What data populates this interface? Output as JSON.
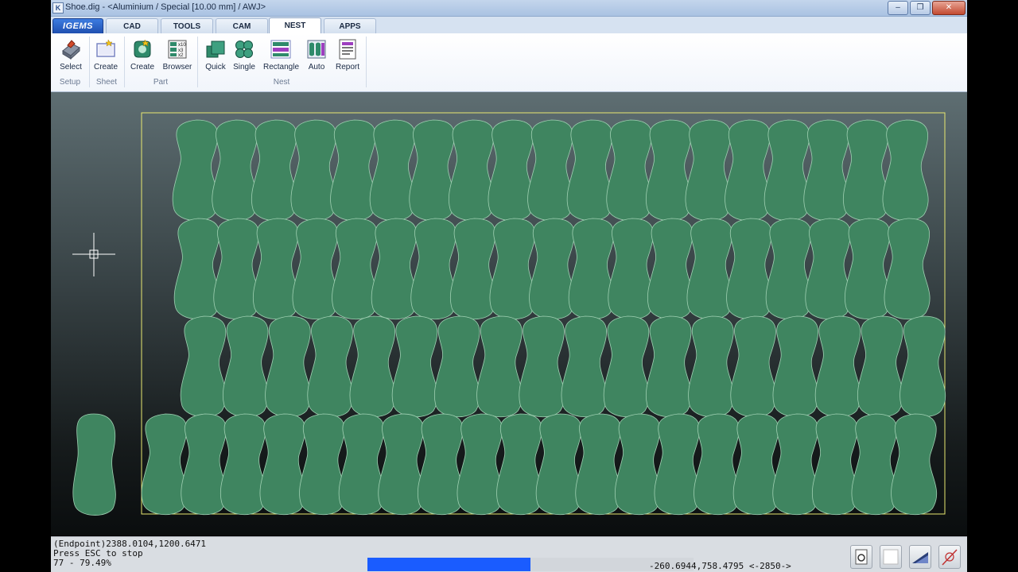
{
  "window": {
    "title": "Shoe.dig - <Aluminium / Special [10.00 mm] / AWJ>",
    "icon": "igems-app-icon",
    "controls": [
      "minimize",
      "maximize",
      "close"
    ]
  },
  "tabs": [
    {
      "label": "IGEMS",
      "logo": true
    },
    {
      "label": "CAD"
    },
    {
      "label": "TOOLS"
    },
    {
      "label": "CAM"
    },
    {
      "label": "NEST",
      "active": true
    },
    {
      "label": "APPS"
    }
  ],
  "ribbon": {
    "buttons": [
      {
        "label": "Select",
        "icon": "select-machine-icon"
      },
      {
        "label": "Create",
        "icon": "create-sheet-icon"
      },
      {
        "label": "Create",
        "icon": "create-part-icon"
      },
      {
        "label": "Browser",
        "icon": "part-browser-icon"
      },
      {
        "label": "Quick",
        "icon": "quick-nest-icon"
      },
      {
        "label": "Single",
        "icon": "single-nest-icon"
      },
      {
        "label": "Rectangle",
        "icon": "rectangle-nest-icon"
      },
      {
        "label": "Auto",
        "icon": "auto-nest-icon"
      },
      {
        "label": "Report",
        "icon": "report-icon"
      }
    ],
    "groups": [
      "Setup",
      "Sheet",
      "Part",
      "Nest"
    ]
  },
  "canvas": {
    "sheet_outline_color": "#e8e870",
    "part_fill_color": "#3f8560",
    "part_edge_color": "#9fd0b2",
    "nested_parts": {
      "rows": 4,
      "per_row": [
        19,
        19,
        18,
        20
      ]
    },
    "crosshair": "cursor-crosshair"
  },
  "status": {
    "line1": "(Endpoint)2388.0104,1200.6471",
    "line2": "Press ESC to stop",
    "line3": "77  -  79.49%",
    "progress_fraction": 0.5,
    "progress_color": "#1a5cff",
    "coordinates": "-260.6944,758.4795 <-2850->",
    "tool_buttons": [
      "snap-mode-icon",
      "blank-square-icon",
      "triangle-icon",
      "disabled-line-icon"
    ]
  }
}
